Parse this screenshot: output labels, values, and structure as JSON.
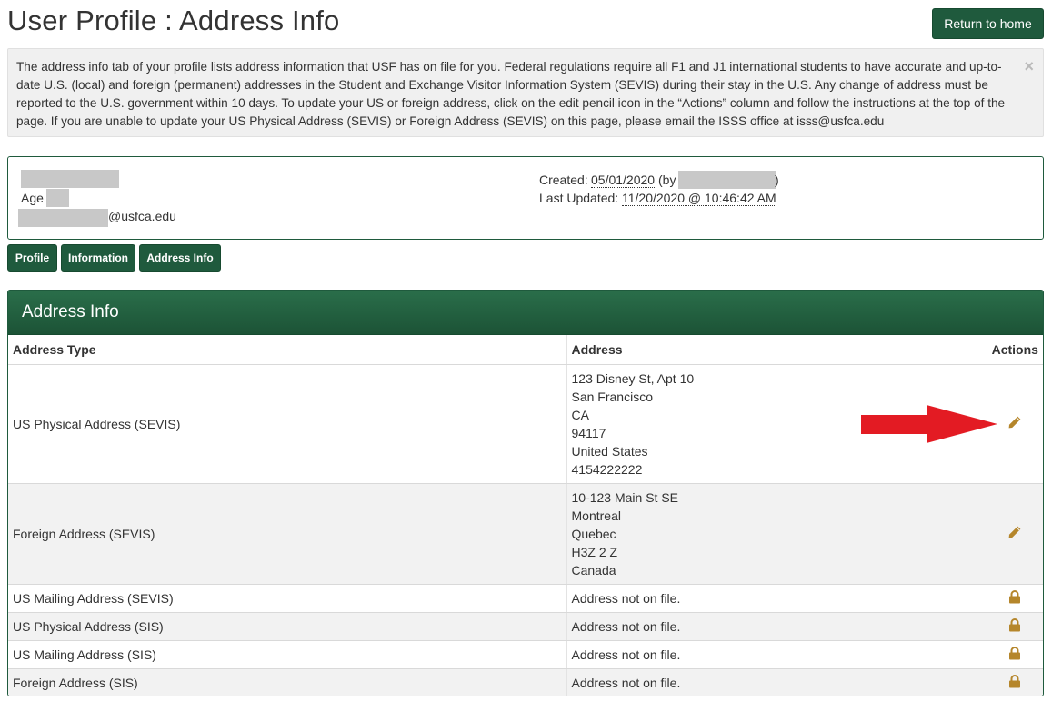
{
  "page": {
    "title": "User Profile : Address Info",
    "return_button": "Return to home"
  },
  "notice": {
    "text": "The address info tab of your profile lists address information that USF has on file for you. Federal regulations require all F1 and J1 international students to have accurate and up-to-date U.S. (local) and foreign (permanent) addresses in the Student and Exchange Visitor Information System (SEVIS) during their stay in the U.S. Any change of address must be reported to the U.S. government within 10 days. To update your US or foreign address, click on the edit pencil icon in the “Actions” column and follow the instructions at the top of the page. If you are unable to update your US Physical Address (SEVIS) or Foreign Address (SEVIS) on this page, please email the ISSS office at isss@usfca.edu",
    "close_icon": "×"
  },
  "profile": {
    "age_label": "Age",
    "email_suffix": "@usfca.edu",
    "created_label": "Created:",
    "created_date": "05/01/2020",
    "created_by_open": "(by",
    "created_by_close": ")",
    "updated_label": "Last Updated:",
    "updated_value": "11/20/2020 @ 10:46:42 AM"
  },
  "tabs": [
    {
      "label": "Profile"
    },
    {
      "label": "Information"
    },
    {
      "label": "Address Info"
    }
  ],
  "panel": {
    "title": "Address Info",
    "columns": {
      "type": "Address Type",
      "address": "Address",
      "actions": "Actions"
    },
    "rows": [
      {
        "type": "US Physical Address (SEVIS)",
        "lines": [
          "123 Disney St, Apt 10",
          "San Francisco",
          "CA",
          "94117",
          "United States",
          "4154222222"
        ],
        "action": "edit-pencil-icon"
      },
      {
        "type": "Foreign Address (SEVIS)",
        "lines": [
          "10-123 Main St SE",
          "Montreal",
          "Quebec",
          "H3Z 2 Z",
          "Canada"
        ],
        "action": "edit-pencil-icon"
      },
      {
        "type": "US Mailing Address (SEVIS)",
        "lines": [
          "Address not on file."
        ],
        "action": "lock-icon"
      },
      {
        "type": "US Physical Address (SIS)",
        "lines": [
          "Address not on file."
        ],
        "action": "lock-icon"
      },
      {
        "type": "US Mailing Address (SIS)",
        "lines": [
          "Address not on file."
        ],
        "action": "lock-icon"
      },
      {
        "type": "Foreign Address (SIS)",
        "lines": [
          "Address not on file."
        ],
        "action": "lock-icon"
      }
    ]
  },
  "colors": {
    "brand_green": "#1f5a3d",
    "icon_gold": "#b5862b",
    "annotation_red": "#e31b23"
  }
}
